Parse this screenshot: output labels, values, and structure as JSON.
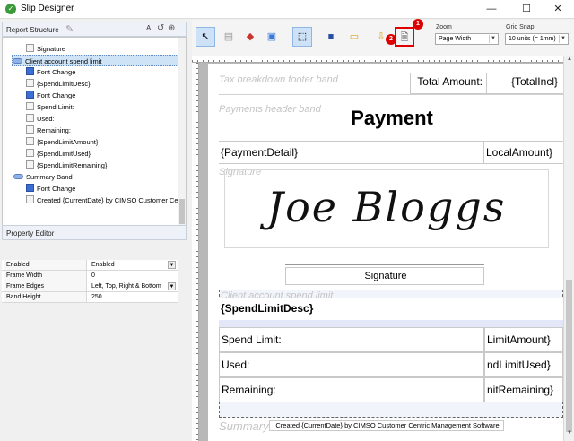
{
  "window": {
    "title": "Slip Designer",
    "minimize": "—",
    "maximize": "☐",
    "close": "✕"
  },
  "report_structure": {
    "header": "Report Structure",
    "items": [
      {
        "label": "Signature",
        "icon": "field-icon"
      },
      {
        "label": "Client account spend limit",
        "icon": "band-icon",
        "selected": true
      },
      {
        "label": "Font Change",
        "icon": "font-icon"
      },
      {
        "label": "{SpendLimitDesc}",
        "icon": "field-icon"
      },
      {
        "label": "Font Change",
        "icon": "font-icon"
      },
      {
        "label": "Spend Limit:",
        "icon": "field-icon"
      },
      {
        "label": "Used:",
        "icon": "field-icon"
      },
      {
        "label": "Remaining:",
        "icon": "field-icon"
      },
      {
        "label": "{SpendLimitAmount}",
        "icon": "field-icon"
      },
      {
        "label": "{SpendLimitUsed}",
        "icon": "field-icon"
      },
      {
        "label": "{SpendLimitRemaining}",
        "icon": "field-icon"
      },
      {
        "label": "Summary Band",
        "icon": "band-icon"
      },
      {
        "label": "Font Change",
        "icon": "font-icon"
      },
      {
        "label": "Created {CurrentDate} by CIMSO Customer Centric",
        "icon": "field-icon"
      }
    ]
  },
  "property_editor": {
    "header": "Property Editor",
    "rows": [
      {
        "key": "Enabled",
        "value": "Enabled",
        "dropdown": true
      },
      {
        "key": "Frame Width",
        "value": "0",
        "dropdown": false
      },
      {
        "key": "Frame Edges",
        "value": "Left, Top, Right & Bottom",
        "dropdown": true
      },
      {
        "key": "Band Height",
        "value": "250",
        "dropdown": false
      }
    ]
  },
  "toolbar": {
    "zoom_label": "Zoom",
    "zoom_value": "Page Width",
    "grid_label": "Grid Snap",
    "grid_value": "10 units (= 1mm)",
    "badge1": "1",
    "badge2": "2"
  },
  "canvas": {
    "tax_footer_label": "Tax breakdown footer band",
    "total_amount_label": "Total Amount:",
    "total_incl": "{TotalIncl}",
    "payments_header_label": "Payments header band",
    "payment_title": "Payment",
    "payment_detail": "{PaymentDetail}",
    "local_amount": "LocalAmount}",
    "signature_band_label": "Signature",
    "signature_name": "Joe Bloggs",
    "signature_caption": "Signature",
    "client_band_label": "Client account spend limit",
    "spend_limit_desc": "{SpendLimitDesc}",
    "spend_limit_label": "Spend Limit:",
    "spend_limit_amount": "LimitAmount}",
    "used_label": "Used:",
    "used_value": "ndLimitUsed}",
    "remaining_label": "Remaining:",
    "remaining_value": "nitRemaining}",
    "summary_band_label": "Summary Band",
    "created_text": "Created {CurrentDate} by CIMSO Customer Centric Management Software"
  }
}
